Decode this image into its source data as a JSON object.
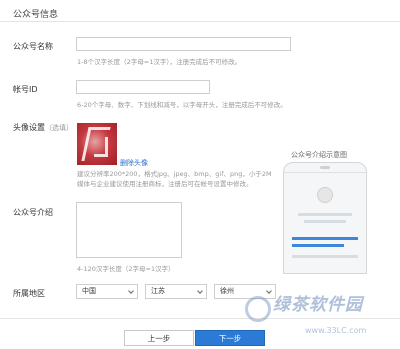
{
  "page": {
    "section_title": "公众号信息"
  },
  "name_field": {
    "label": "公众号名称",
    "value": "",
    "hint": "1-8个汉字长度（2字母=1汉字），注册完成后不可修改。"
  },
  "account_id_field": {
    "label": "帐号ID",
    "value": "",
    "hint": "6-20个字母、数字、下划线和减号，以字母开头，注册完成后不可修改。"
  },
  "avatar_field": {
    "label": "头像设置",
    "optional": "（选填）",
    "delete_label": "删除头像",
    "hint_line1": "建议分辨率200*200，格式jpg、jpeg、bmp、gif、png，小于2M",
    "hint_line2": "媒体与企业建议使用注册商标，注册后可在帐号设置中修改。"
  },
  "intro_field": {
    "label": "公众号介绍",
    "value": "",
    "hint": "4-120汉字长度（2字母=1汉字）"
  },
  "preview": {
    "caption": "公众号介绍示意图"
  },
  "region_field": {
    "label": "所属地区",
    "country": "中国",
    "province": "江苏",
    "city": "徐州"
  },
  "buttons": {
    "prev": "上一步",
    "next": "下一步"
  },
  "watermark": {
    "text": "绿茶软件园",
    "url": "www.33LC.com"
  },
  "colors": {
    "accent": "#2b7ad6",
    "link": "#2b6cc4",
    "hint": "#999999",
    "border": "#cfcfcf"
  }
}
